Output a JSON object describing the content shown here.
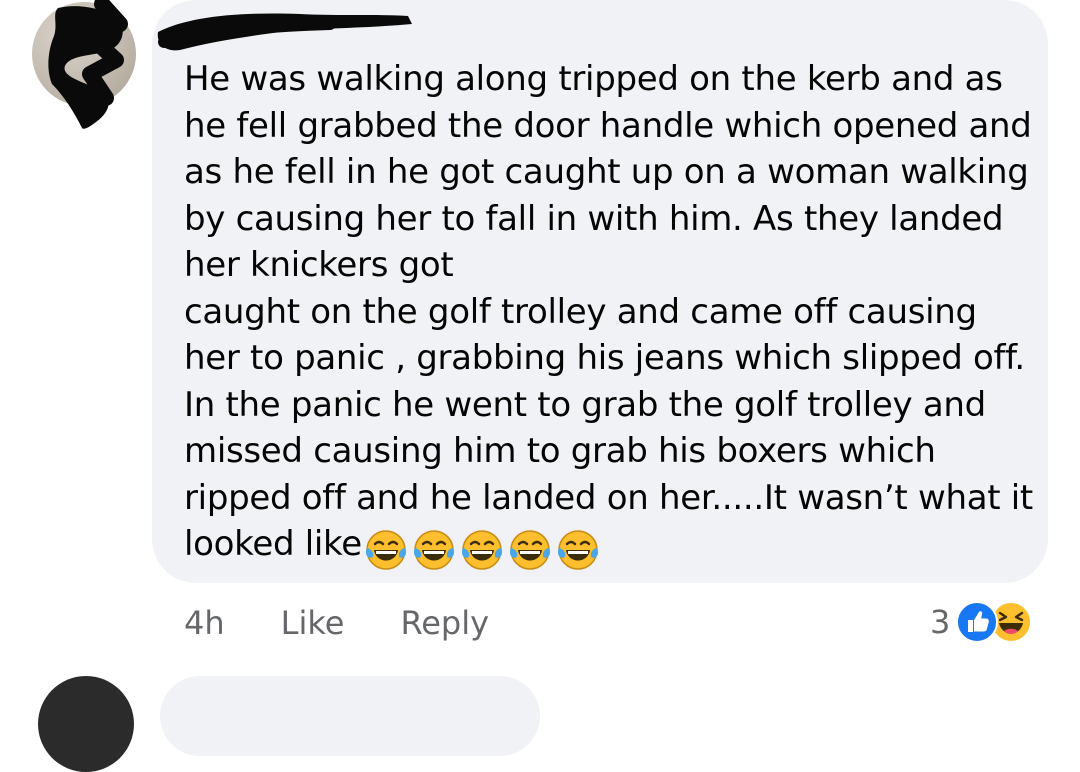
{
  "comment": {
    "author_name": "",
    "text_lines": [
      "He was walking along tripped on the kerb and as",
      "he fell grabbed the door handle which opened and",
      "as he fell in he got caught up on a woman walking",
      "by causing her to fall in with him. As they landed",
      "her knickers got",
      "caught on the golf trolley and came off causing",
      "her to panic , grabbing his jeans which slipped off.",
      "In the panic he went to grab the golf trolley and",
      "missed causing him to grab his boxers which",
      "ripped off and he landed on her.....It wasn’t what it",
      "looked like"
    ],
    "trailing_emoji": [
      "laughing-tears-icon",
      "laughing-tears-icon",
      "laughing-tears-icon",
      "laughing-tears-icon",
      "laughing-tears-icon"
    ],
    "timestamp": "4h",
    "like_label": "Like",
    "reply_label": "Reply",
    "reaction_count": "3",
    "reactions": [
      "like-reaction-icon",
      "haha-reaction-icon"
    ]
  },
  "colors": {
    "bubble": "#f0f2f5",
    "text": "#050505",
    "secondary_text": "#65676b",
    "like_blue": "#1877f2",
    "emoji_yellow": "#fdbf2d"
  }
}
